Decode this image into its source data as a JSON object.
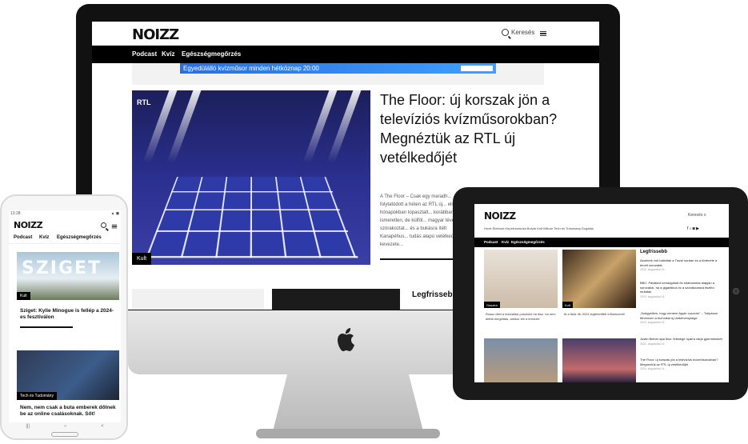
{
  "brand": {
    "logo": "NOIZZ"
  },
  "desktop": {
    "search_label": "Keresés",
    "nav": [
      "Podcast",
      "Kvíz",
      "Egészségmegőrzés"
    ],
    "banner_text": "Egyedülálló kvízműsor minden hétköznap 20:00",
    "hero": {
      "rtl": "RTL",
      "badge": "Kult",
      "title": "The Floor: új korszak jön a televíziós kvízműsorokban? Megnéztük az RTL új vetélkedőjét",
      "excerpt": "A The Floor – Csak egy maradh... folytatódott a héten az RTL új... elmúlt hónapokban topasztalt... korábban ismeretlen, de külföl... magyar tévénézők szórakoztat... és a bukásra ítélt Kanapéhus... tudás alapú vetélkedő kevezete..."
    },
    "legfrissebb": "Legfrissebb"
  },
  "phone": {
    "status_time": "13:28",
    "status_icons": "▲ ◼",
    "nav": [
      "Podcast",
      "Kvíz",
      "Egészségmegőrzés"
    ],
    "sziget_word": "SZIGET",
    "article1": {
      "badge": "Kult",
      "title": "Sziget: Kylie Minogue is fellép a 2024-es fesztiválon"
    },
    "article2": {
      "badge": "Tech és Tudomány",
      "title": "Nem, nem csak a buta emberek dőlnek be az online csalásoknak. Sőt!"
    },
    "navbar": [
      "|||",
      "○",
      "<"
    ]
  },
  "tablet": {
    "search_label": "Keresés",
    "topnav": "Hírek   Életmód   Képek/sztorizá   Bulvár   Kult   Mikron   Tech és Tudomány   Dogatás",
    "social": "f  ♪  ◙  ▶",
    "nav": [
      "Podcast",
      "Kvíz",
      "Egészségmegőrzés"
    ],
    "card1": {
      "badge": "Gasztró",
      "caption": "Rossz ötlet a tetoválást posztolni ha lesz, ha nem diétát megoldás, amikor lee a tervezte"
    },
    "card2": {
      "badge": "Kult",
      "caption": "Itt a lista: ők 2024 legtehetőbb influencerei!"
    },
    "sidebar_title": "Legfrissebb",
    "sidebar": [
      {
        "title": "Azahírek volt hallottak a Tisza! sorban és a története a tervét sorozatát",
        "date": "2024. augusztus 01."
      },
      {
        "title": "BBC: Pataskot tornázgatott és strabonokat alapján a sorozatok, ha a gigantikus ez a szórakozásra tisztító mutatás",
        "date": "2024. augusztus 01."
      },
      {
        "title": "„Szégyellem, hogy nemem Apple cucccim\" – Tulipánon fűrvencen a technikai új ránkérvénysége",
        "date": "2024. augusztus 01."
      },
      {
        "title": "Justin Bieber apa lesz: felesége nyárra várja gyermekükét",
        "date": "2024. augusztus 01."
      },
      {
        "title": "The Floor: új korszak jön a televíziós kvízműsorokban? Megnéztük az RTL új vetélkedőjét",
        "date": "2024. augusztus 01."
      }
    ]
  },
  "colors": {
    "black": "#000000",
    "banner_blue": "#2a6fe0",
    "hero_blue": "#2b2f8e"
  }
}
